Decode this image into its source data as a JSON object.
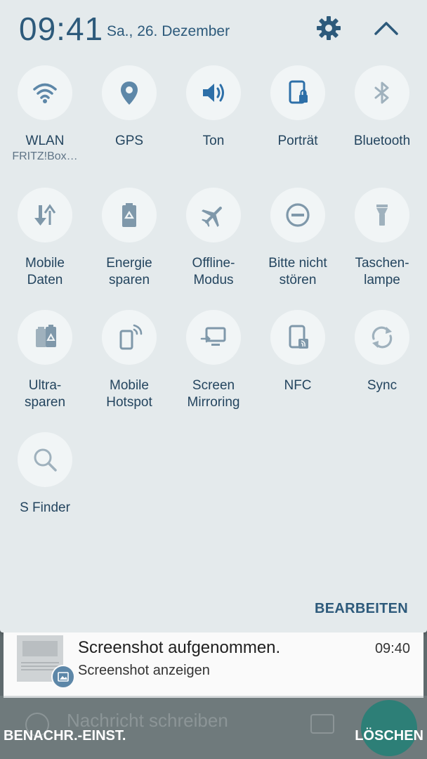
{
  "header": {
    "time": "09:41",
    "date": "Sa., 26. Dezember"
  },
  "colors": {
    "accent": "#2d5a7b",
    "icon": "#5d87a8",
    "panel": "#e4eaec",
    "tile": "#f1f5f6"
  },
  "tiles": [
    {
      "label": "WLAN",
      "sub": "FRITZ!Box…",
      "icon": "wifi-icon"
    },
    {
      "label": "GPS",
      "icon": "location-pin-icon"
    },
    {
      "label": "Ton",
      "icon": "speaker-icon"
    },
    {
      "label": "Porträt",
      "icon": "portrait-lock-icon"
    },
    {
      "label": "Bluetooth",
      "icon": "bluetooth-icon"
    },
    {
      "label": "Mobile\nDaten",
      "icon": "data-arrows-icon"
    },
    {
      "label": "Energie\nsparen",
      "icon": "battery-recycle-icon"
    },
    {
      "label": "Offline-\nModus",
      "icon": "airplane-icon"
    },
    {
      "label": "Bitte nicht\nstören",
      "icon": "do-not-disturb-icon"
    },
    {
      "label": "Taschen-\nlampe",
      "icon": "flashlight-icon"
    },
    {
      "label": "Ultra-\nsparen",
      "icon": "ultra-battery-icon"
    },
    {
      "label": "Mobile\nHotspot",
      "icon": "hotspot-icon"
    },
    {
      "label": "Screen\nMirroring",
      "icon": "screen-mirror-icon"
    },
    {
      "label": "NFC",
      "icon": "nfc-icon"
    },
    {
      "label": "Sync",
      "icon": "sync-icon"
    },
    {
      "label": "S Finder",
      "icon": "search-icon"
    }
  ],
  "edit_label": "BEARBEITEN",
  "notification": {
    "title": "Screenshot aufgenommen.",
    "text": "Screenshot anzeigen",
    "time": "09:40"
  },
  "background": {
    "compose_placeholder": "Nachricht schreiben"
  },
  "footer": {
    "settings_label": "BENACHR.-EINST.",
    "clear_label": "LÖSCHEN"
  }
}
